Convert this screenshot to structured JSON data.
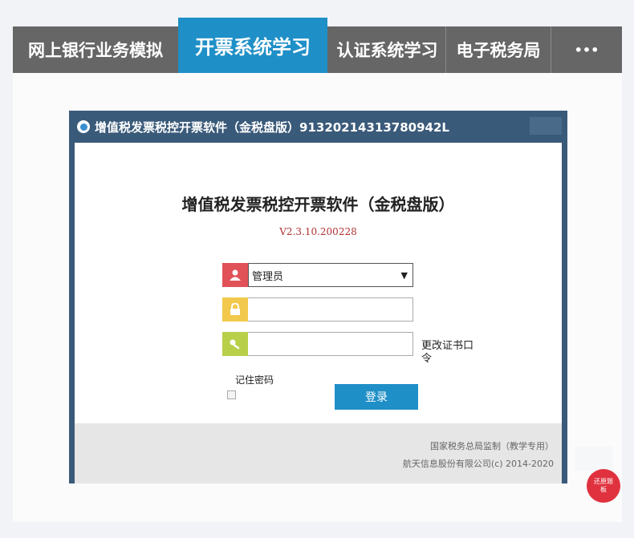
{
  "nav": {
    "tabs": [
      {
        "label": "网上银行业务模拟"
      },
      {
        "label": "开票系统学习",
        "active": true
      },
      {
        "label": "认证系统学习"
      },
      {
        "label": "电子税务局"
      },
      {
        "label": "•••"
      }
    ]
  },
  "window": {
    "title": "增值税发票税控开票软件（金税盘版）91320214313780942L",
    "heading": "增值税发票税控开票软件（金税盘版）",
    "version": "V2.3.10.200228",
    "user_select": {
      "value": "管理员"
    },
    "password_field": {
      "value": ""
    },
    "cert_field": {
      "value": ""
    },
    "change_cert_link": "更改证书口令",
    "remember_label": "记住密码",
    "login_button": "登录",
    "footer": {
      "line1": "国家税务总局监制（教学专用）",
      "line2": "航天信息股份有限公司(c) 2014-2020"
    }
  },
  "float_button": {
    "label": "还原题板"
  },
  "colors": {
    "accent": "#1f8fc7",
    "nav_bg": "#666666",
    "window_frame": "#3a5a7a",
    "user_icon_bg": "#e05258",
    "lock_icon_bg": "#f2c94c",
    "key_icon_bg": "#b8cf4a",
    "float_button_bg": "#e0323e"
  },
  "icons": [
    "app-logo-icon",
    "user-icon",
    "lock-icon",
    "key-icon",
    "dropdown-arrow-icon"
  ]
}
